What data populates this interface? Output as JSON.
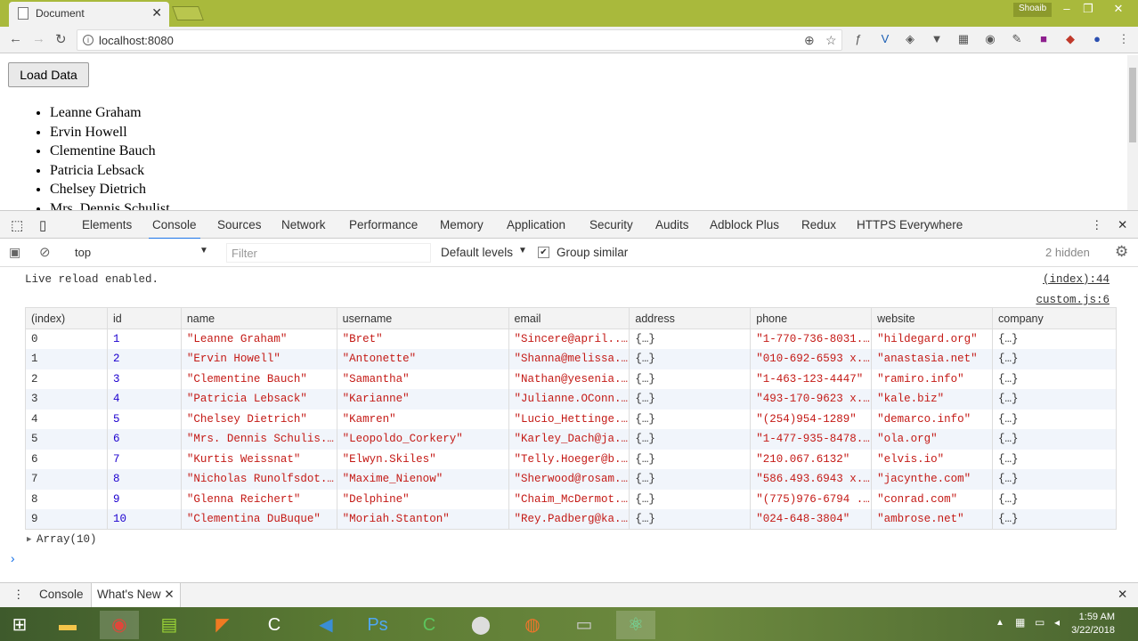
{
  "browser": {
    "tab_title": "Document",
    "user": "Shoaib",
    "url": "localhost:8080"
  },
  "page": {
    "load_button": "Load Data",
    "names": [
      "Leanne Graham",
      "Ervin Howell",
      "Clementine Bauch",
      "Patricia Lebsack",
      "Chelsey Dietrich",
      "Mrs. Dennis Schulist"
    ]
  },
  "devtools": {
    "tabs": [
      "Elements",
      "Console",
      "Sources",
      "Network",
      "Performance",
      "Memory",
      "Application",
      "Security",
      "Audits",
      "Adblock Plus",
      "Redux",
      "HTTPS Everywhere"
    ],
    "context": "top",
    "filter_placeholder": "Filter",
    "levels": "Default levels",
    "group_similar": "Group similar",
    "hidden": "2 hidden",
    "log_message": "Live reload enabled.",
    "log_source": "(index):44",
    "table_source": "custom.js:6",
    "array_label": "Array(10)",
    "prompt": "›",
    "drawer_tabs": [
      "Console",
      "What's New"
    ]
  },
  "table": {
    "headers": [
      "(index)",
      "id",
      "name",
      "username",
      "email",
      "address",
      "phone",
      "website",
      "company"
    ],
    "rows": [
      [
        "0",
        "1",
        "\"Leanne Graham\"",
        "\"Bret\"",
        "\"Sincere@april....",
        "{…}",
        "\"1-770-736-8031...",
        "\"hildegard.org\"",
        "{…}"
      ],
      [
        "1",
        "2",
        "\"Ervin Howell\"",
        "\"Antonette\"",
        "\"Shanna@melissa...",
        "{…}",
        "\"010-692-6593 x...",
        "\"anastasia.net\"",
        "{…}"
      ],
      [
        "2",
        "3",
        "\"Clementine Bauch\"",
        "\"Samantha\"",
        "\"Nathan@yesenia...",
        "{…}",
        "\"1-463-123-4447\"",
        "\"ramiro.info\"",
        "{…}"
      ],
      [
        "3",
        "4",
        "\"Patricia Lebsack\"",
        "\"Karianne\"",
        "\"Julianne.OConn...",
        "{…}",
        "\"493-170-9623 x...",
        "\"kale.biz\"",
        "{…}"
      ],
      [
        "4",
        "5",
        "\"Chelsey Dietrich\"",
        "\"Kamren\"",
        "\"Lucio_Hettinge...",
        "{…}",
        "\"(254)954-1289\"",
        "\"demarco.info\"",
        "{…}"
      ],
      [
        "5",
        "6",
        "\"Mrs. Dennis Schulis...",
        "\"Leopoldo_Corkery\"",
        "\"Karley_Dach@ja...",
        "{…}",
        "\"1-477-935-8478...",
        "\"ola.org\"",
        "{…}"
      ],
      [
        "6",
        "7",
        "\"Kurtis Weissnat\"",
        "\"Elwyn.Skiles\"",
        "\"Telly.Hoeger@b...",
        "{…}",
        "\"210.067.6132\"",
        "\"elvis.io\"",
        "{…}"
      ],
      [
        "7",
        "8",
        "\"Nicholas Runolfsdot...",
        "\"Maxime_Nienow\"",
        "\"Sherwood@rosam...",
        "{…}",
        "\"586.493.6943 x...",
        "\"jacynthe.com\"",
        "{…}"
      ],
      [
        "8",
        "9",
        "\"Glenna Reichert\"",
        "\"Delphine\"",
        "\"Chaim_McDermot...",
        "{…}",
        "\"(775)976-6794 ...",
        "\"conrad.com\"",
        "{…}"
      ],
      [
        "9",
        "10",
        "\"Clementina DuBuque\"",
        "\"Moriah.Stanton\"",
        "\"Rey.Padberg@ka...",
        "{…}",
        "\"024-648-3804\"",
        "\"ambrose.net\"",
        "{…}"
      ]
    ]
  },
  "taskbar": {
    "time": "1:59 AM",
    "date": "3/22/2018"
  }
}
